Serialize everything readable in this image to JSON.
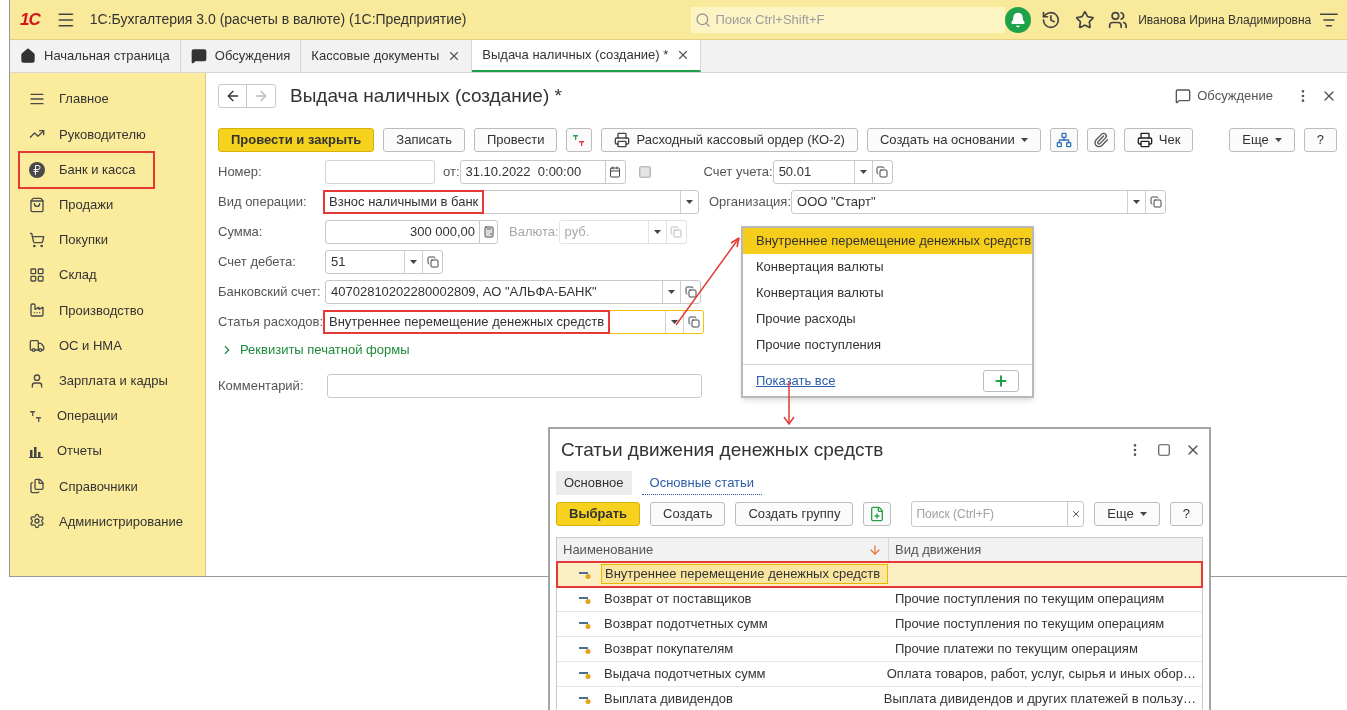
{
  "app_bar": {
    "logo": "1С",
    "title": "1С:Бухгалтерия 3.0 (расчеты в валюте)  (1С:Предприятие)",
    "search": {
      "placeholder": "Поиск Ctrl+Shift+F"
    },
    "user": "Иванова Ирина Владимировна"
  },
  "tabs": [
    {
      "label": "Начальная страница",
      "kind": "home",
      "selected": false,
      "closable": false
    },
    {
      "label": "Обсуждения",
      "kind": "chat",
      "selected": false,
      "closable": false
    },
    {
      "label": "Кассовые документы",
      "kind": "plain",
      "selected": false,
      "closable": true
    },
    {
      "label": "Выдача наличных (создание) *",
      "kind": "plain",
      "selected": true,
      "closable": true
    }
  ],
  "sidebar": {
    "items": [
      {
        "label": "Главное",
        "highlighted": false
      },
      {
        "label": "Руководителю",
        "highlighted": false
      },
      {
        "label": "Банк и касса",
        "highlighted": true
      },
      {
        "label": "Продажи",
        "highlighted": false
      },
      {
        "label": "Покупки",
        "highlighted": false
      },
      {
        "label": "Склад",
        "highlighted": false
      },
      {
        "label": "Производство",
        "highlighted": false
      },
      {
        "label": "ОС и НМА",
        "highlighted": false
      },
      {
        "label": "Зарплата и кадры",
        "highlighted": false
      },
      {
        "label": "Операции",
        "highlighted": false
      },
      {
        "label": "Отчеты",
        "highlighted": false
      },
      {
        "label": "Справочники",
        "highlighted": false
      },
      {
        "label": "Администрирование",
        "highlighted": false
      }
    ]
  },
  "form": {
    "title": "Выдача наличных (создание) *",
    "discussion": "Обсуждение",
    "toolbar": [
      {
        "kind": "primary",
        "label": "Провести и закрыть"
      },
      {
        "kind": "button",
        "label": "Записать"
      },
      {
        "kind": "button",
        "label": "Провести"
      },
      {
        "kind": "dtkt"
      },
      {
        "kind": "print",
        "label": "Расходный кассовый ордер (КО-2)"
      },
      {
        "kind": "menu",
        "label": "Создать на основании"
      },
      {
        "kind": "structure"
      },
      {
        "kind": "attach"
      },
      {
        "kind": "receipt",
        "label": "Чек"
      }
    ],
    "toolbar_right": [
      {
        "kind": "menu",
        "label": "Еще"
      },
      {
        "kind": "button",
        "label": "?"
      }
    ],
    "fields": {
      "number": {
        "label": "Номер:"
      },
      "date": {
        "label": "от:",
        "value": "31.10.2022  0:00:00"
      },
      "account": {
        "label": "Счет учета:",
        "value": "50.01"
      },
      "operation": {
        "label": "Вид операции:",
        "value": "Взнос наличными в банк",
        "highlighted": true
      },
      "organization": {
        "label": "Организация:",
        "value": "ООО \"Старт\""
      },
      "amount": {
        "label": "Сумма:",
        "value": "300 000,00"
      },
      "currency": {
        "label": "Валюта:",
        "value": "руб.",
        "disabled": true
      },
      "debit_account": {
        "label": "Счет дебета:",
        "value": "51"
      },
      "bank_account": {
        "label": "Банковский счет:",
        "value": "40702810202280002809, АО \"АЛЬФА-БАНК\""
      },
      "expense_item": {
        "label": "Статья расходов:",
        "value": "Внутреннее перемещение денежных средств",
        "highlighted": true,
        "focused": true
      },
      "print_details": {
        "label": "Реквизиты печатной формы",
        "expanded": false
      },
      "comment": {
        "label": "Комментарий:"
      }
    }
  },
  "dropdown": {
    "items": [
      {
        "label": "Внутреннее перемещение денежных средств",
        "selected": true
      },
      {
        "label": "Конвертация валюты",
        "selected": false
      },
      {
        "label": "Конвертация валюты",
        "selected": false
      },
      {
        "label": "Прочие расходы",
        "selected": false
      },
      {
        "label": "Прочие поступления",
        "selected": false
      }
    ],
    "show_all": "Показать все"
  },
  "dialog": {
    "title": "Статьи движения денежных средств",
    "tabs": [
      {
        "label": "Основное",
        "selected": true
      },
      {
        "label": "Основные статьи",
        "selected": false
      }
    ],
    "buttons": [
      {
        "kind": "primary",
        "label": "Выбрать"
      },
      {
        "kind": "button",
        "label": "Создать"
      },
      {
        "kind": "button",
        "label": "Создать группу"
      },
      {
        "kind": "copy"
      }
    ],
    "search": {
      "placeholder": "Поиск (Ctrl+F)"
    },
    "more": "Еще",
    "help": "?",
    "table": {
      "columns": [
        "Наименование",
        "Вид движения"
      ],
      "rows": [
        {
          "name": "Внутреннее перемещение денежных средств",
          "selected": true,
          "highlighted": true
        },
        {
          "name": "Возврат от поставщиков",
          "movement": "Прочие поступления по текущим операциям",
          "selected": false,
          "highlighted": false
        },
        {
          "name": "Возврат подотчетных сумм",
          "movement": "Прочие поступления по текущим операциям",
          "selected": false,
          "highlighted": false
        },
        {
          "name": "Возврат покупателям",
          "movement": "Прочие платежи по текущим операциям",
          "selected": false,
          "highlighted": false
        },
        {
          "name": "Выдача подотчетных сумм",
          "movement": "Оплата товаров, работ, услуг, сырья и иных обор…",
          "selected": false,
          "highlighted": false
        },
        {
          "name": "Выплата дивидендов",
          "movement": "Выплата дивидендов и других платежей в пользу…",
          "selected": false,
          "highlighted": false
        }
      ]
    }
  }
}
